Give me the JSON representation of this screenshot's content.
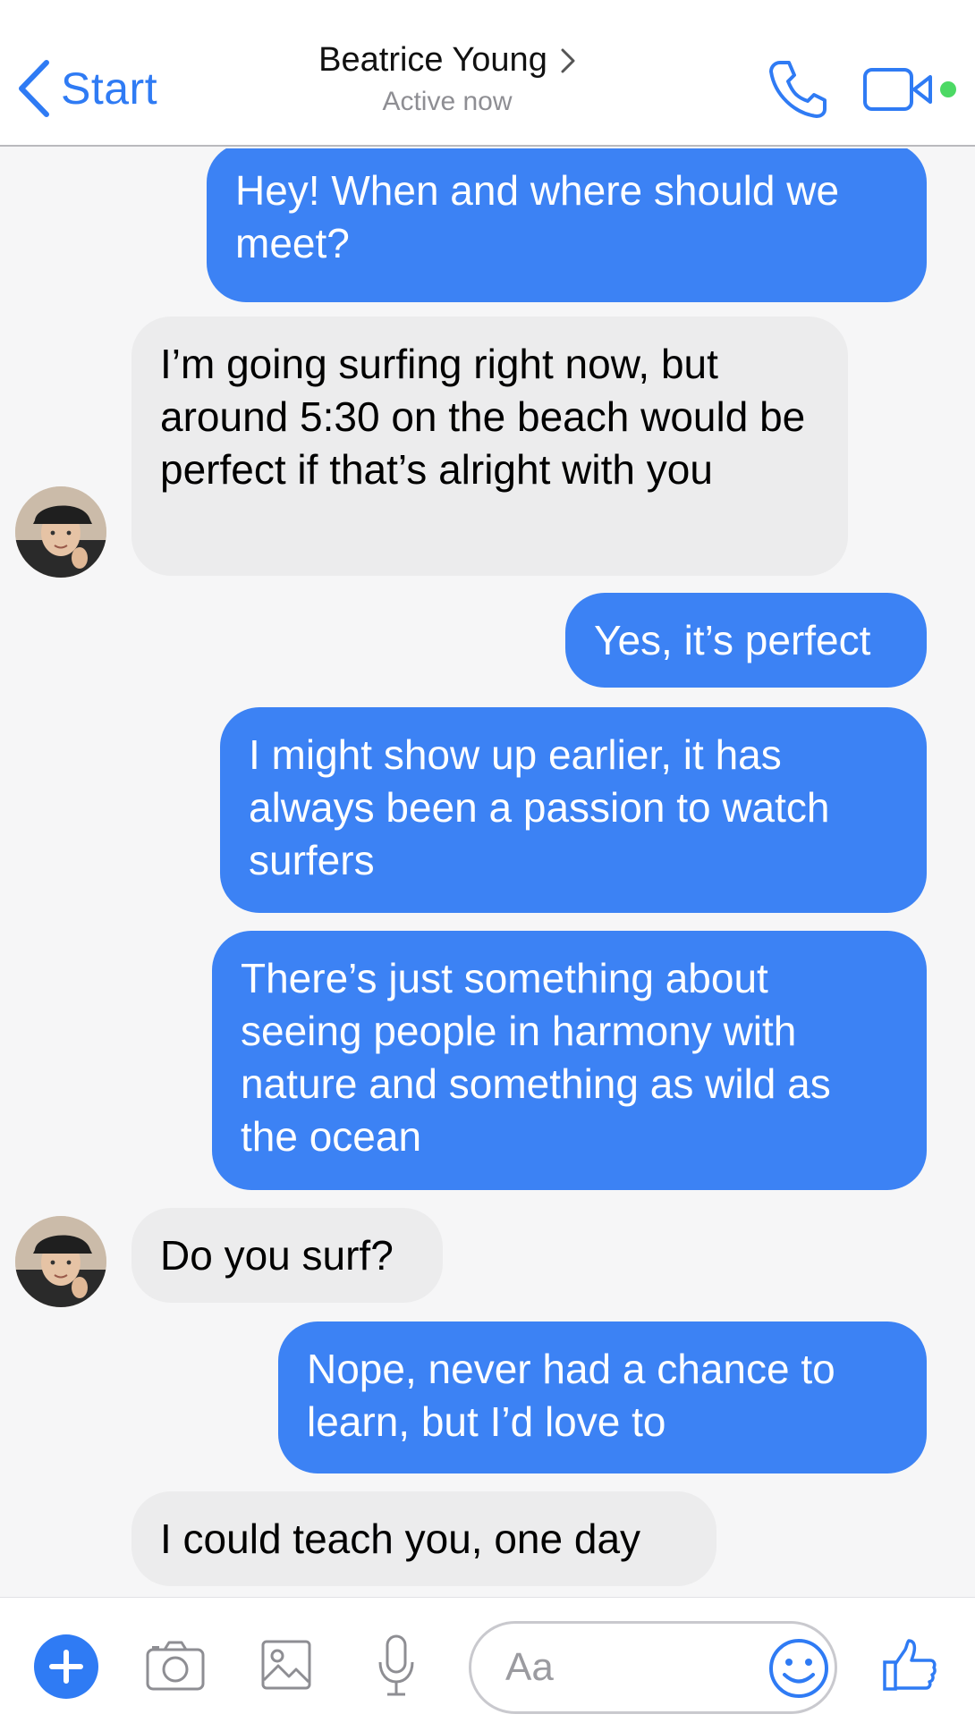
{
  "header": {
    "back_label": "Start",
    "contact_name": "Beatrice Young",
    "status": "Active now",
    "icons": [
      "chevron-left-icon",
      "chevron-right-icon",
      "phone-icon",
      "video-camera-icon"
    ],
    "active_dot_color": "#4cd964"
  },
  "messages": [
    {
      "from": "me",
      "text": "Hey! When and where should we meet?"
    },
    {
      "from": "them",
      "text": "I’m going surfing right now, but around 5:30 on the beach would be perfect if that’s alright with you"
    },
    {
      "from": "me",
      "text": "Yes, it’s perfect"
    },
    {
      "from": "me",
      "text": "I might show up earlier, it has always been a passion to watch surfers"
    },
    {
      "from": "me",
      "text": "There’s just something about seeing people in harmony with nature and something as wild as the ocean"
    },
    {
      "from": "them",
      "text": "Do you surf?"
    },
    {
      "from": "me",
      "text": "Nope, never had a chance to learn, but I’d love to"
    },
    {
      "from": "them",
      "text": "I could teach you, one day"
    }
  ],
  "composer": {
    "placeholder": "Aa",
    "icons": [
      "plus-icon",
      "camera-icon",
      "image-icon",
      "microphone-icon",
      "smiley-icon",
      "thumbs-up-icon"
    ]
  },
  "colors": {
    "accent": "#2f7bf4",
    "outgoing_bubble": "#3c82f4",
    "incoming_bubble": "#ececed",
    "background": "#f6f6f7"
  }
}
